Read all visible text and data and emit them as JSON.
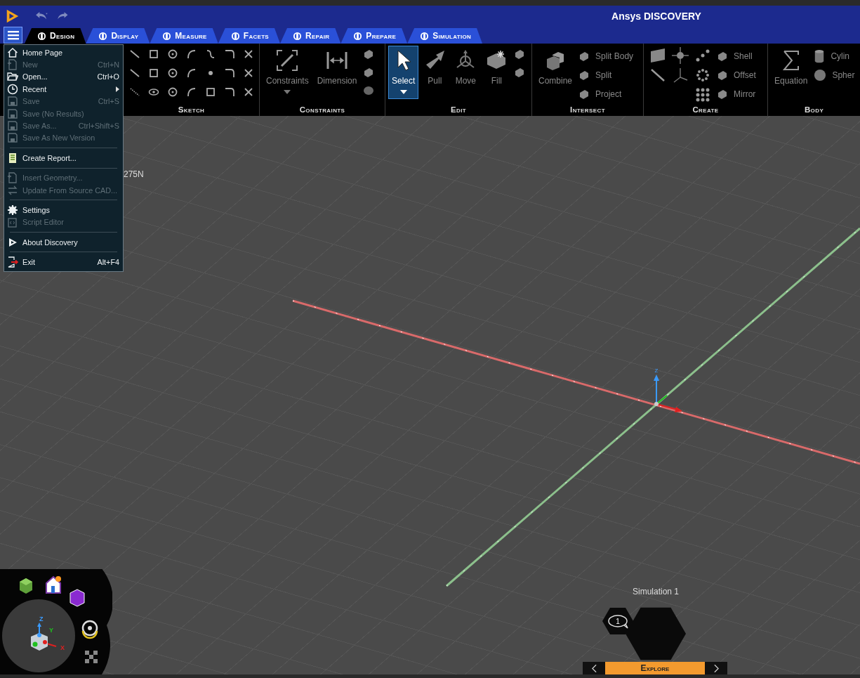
{
  "title_bar": {
    "title": "Ansys DISCOVERY"
  },
  "tabs": [
    {
      "label": "Design",
      "selected": true
    },
    {
      "label": "Display",
      "selected": false
    },
    {
      "label": "Measure",
      "selected": false
    },
    {
      "label": "Facets",
      "selected": false
    },
    {
      "label": "Repair",
      "selected": false
    },
    {
      "label": "Prepare",
      "selected": false
    },
    {
      "label": "Simulation",
      "selected": false
    }
  ],
  "ribbon": {
    "groups": [
      {
        "kind": "sketch",
        "label": "Sketch"
      },
      {
        "kind": "constraints",
        "label": "Constraints",
        "large": [
          {
            "label": "Constraints",
            "dropdown": true
          },
          {
            "label": "Dimension",
            "dropdown": false
          }
        ]
      },
      {
        "kind": "edit",
        "label": "Edit",
        "large": [
          {
            "label": "Select",
            "selected": true,
            "dropdown": true
          },
          {
            "label": "Pull",
            "selected": false,
            "dropdown": false
          },
          {
            "label": "Move",
            "selected": false,
            "dropdown": false
          },
          {
            "label": "Fill",
            "selected": false,
            "dropdown": false
          }
        ]
      },
      {
        "kind": "intersect",
        "label": "Intersect",
        "large": [
          {
            "label": "Combine",
            "dropdown": false
          }
        ],
        "small": [
          "Split Body",
          "Split",
          "Project"
        ]
      },
      {
        "kind": "create",
        "label": "Create",
        "small": [
          "Shell",
          "Offset",
          "Mirror"
        ]
      },
      {
        "kind": "body",
        "label": "Body",
        "large": [
          {
            "label": "Equation",
            "dropdown": false
          }
        ],
        "small": [
          "Cylin",
          "Spher"
        ]
      }
    ]
  },
  "file_menu": {
    "items": [
      {
        "kind": "item",
        "label": "Home Page",
        "disabled": false
      },
      {
        "kind": "item",
        "label": "New",
        "shortcut": "Ctrl+N",
        "disabled": true
      },
      {
        "kind": "item",
        "label": "Open...",
        "shortcut": "Ctrl+O",
        "disabled": false
      },
      {
        "kind": "item",
        "label": "Recent",
        "disabled": false,
        "submenu": true
      },
      {
        "kind": "item",
        "label": "Save",
        "shortcut": "Ctrl+S",
        "disabled": true
      },
      {
        "kind": "item",
        "label": "Save (No Results)",
        "disabled": true
      },
      {
        "kind": "item",
        "label": "Save As...",
        "shortcut": "Ctrl+Shift+S",
        "disabled": true
      },
      {
        "kind": "item",
        "label": "Save As New Version",
        "disabled": true
      },
      {
        "kind": "separator"
      },
      {
        "kind": "item",
        "label": "Create Report...",
        "disabled": false
      },
      {
        "kind": "separator"
      },
      {
        "kind": "item",
        "label": "Insert Geometry...",
        "disabled": true
      },
      {
        "kind": "item",
        "label": "Update From Source CAD...",
        "disabled": true
      },
      {
        "kind": "separator"
      },
      {
        "kind": "item",
        "label": "Settings",
        "disabled": false
      },
      {
        "kind": "item",
        "label": "Script Editor",
        "disabled": true
      },
      {
        "kind": "separator"
      },
      {
        "kind": "item",
        "label": "About Discovery",
        "disabled": false
      },
      {
        "kind": "separator"
      },
      {
        "kind": "item",
        "label": "Exit",
        "shortcut": "Alt+F4",
        "disabled": false
      }
    ]
  },
  "viewport": {
    "material_label": "275N",
    "triad_label": "Z",
    "simulation_label": "Simulation 1",
    "message_count": "1",
    "bottom_tab": "Explore",
    "view_cube": {
      "z_label": "Z",
      "y_label": "Y",
      "x_label": "X"
    }
  }
}
